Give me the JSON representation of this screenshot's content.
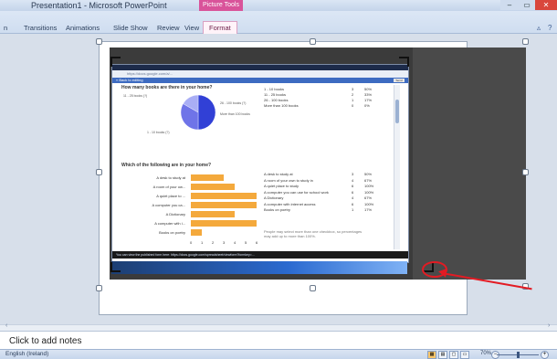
{
  "window": {
    "title": "Presentation1 - Microsoft PowerPoint",
    "context_title": "Picture Tools",
    "minimize": "–",
    "restore": "▭",
    "close": "✕"
  },
  "ribbon": {
    "tabs": [
      "n",
      "Transitions",
      "Animations",
      "Slide Show",
      "Review",
      "View",
      "Format"
    ],
    "active_tab": "Format",
    "help_icon": "question-icon"
  },
  "screenshot": {
    "url": "https://docs.google.com/a/...",
    "bluebar_link": "« Back to editing",
    "send_label": "Send",
    "q1": "How many books are there in your home?",
    "pie_labels": [
      "11 - 25 books (?)",
      "26 - 100 books (?)",
      "More than 100 books",
      "1 - 10 books (?)"
    ],
    "stats1": [
      {
        "label": "1 - 10 books",
        "count": "3",
        "pct": "50%"
      },
      {
        "label": "11 - 25 books",
        "count": "2",
        "pct": "33%"
      },
      {
        "label": "26 - 100 books",
        "count": "1",
        "pct": "17%"
      },
      {
        "label": "More than 100 books",
        "count": "0",
        "pct": "0%"
      }
    ],
    "q2": "Which of the following are in your home?",
    "bar_labels": [
      "A desk to study at",
      "A room of your ow...",
      "A quiet place to ...",
      "A computer you ca...",
      "A Dictionary",
      "A computer with i...",
      "Books on poetry"
    ],
    "bar_ticks": [
      "0",
      "1",
      "2",
      "3",
      "4",
      "5",
      "6"
    ],
    "stats2": [
      {
        "label": "A desk to study at",
        "count": "3",
        "pct": "50%"
      },
      {
        "label": "A room of your own to study in",
        "count": "4",
        "pct": "67%"
      },
      {
        "label": "A quiet place to study",
        "count": "6",
        "pct": "100%"
      },
      {
        "label": "A computer you can use for school work",
        "count": "6",
        "pct": "100%"
      },
      {
        "label": "A Dictionary",
        "count": "4",
        "pct": "67%"
      },
      {
        "label": "A computer with internet access",
        "count": "6",
        "pct": "100%"
      },
      {
        "label": "Books on poetry",
        "count": "1",
        "pct": "17%"
      }
    ],
    "note": "People may select more than one checkbox, so percentages may add up to more than 100%.",
    "bottom_text": "You can view the published form here: https://docs.google.com/spreadsheet/viewform?formkey=..."
  },
  "chart_data": [
    {
      "type": "pie",
      "categories": [
        "1 - 10 books",
        "11 - 25 books",
        "26 - 100 books",
        "More than 100 books"
      ],
      "values": [
        3,
        2,
        1,
        0
      ],
      "colors": [
        "#3140d6",
        "#6f74e8",
        "#a9aef5",
        "#d8dbfb"
      ]
    },
    {
      "type": "bar",
      "categories": [
        "A desk to study at",
        "A room of your own to study in",
        "A quiet place to study",
        "A computer you can use for school work",
        "A Dictionary",
        "A computer with internet access",
        "Books on poetry"
      ],
      "values": [
        3,
        4,
        6,
        6,
        4,
        6,
        1
      ],
      "xlim": [
        0,
        6
      ]
    }
  ],
  "notes": {
    "placeholder": "Click to add notes"
  },
  "status": {
    "language": "English (Ireland)",
    "zoom": "70%",
    "zoom_fraction": 0.5,
    "minus": "−",
    "plus": "+"
  }
}
